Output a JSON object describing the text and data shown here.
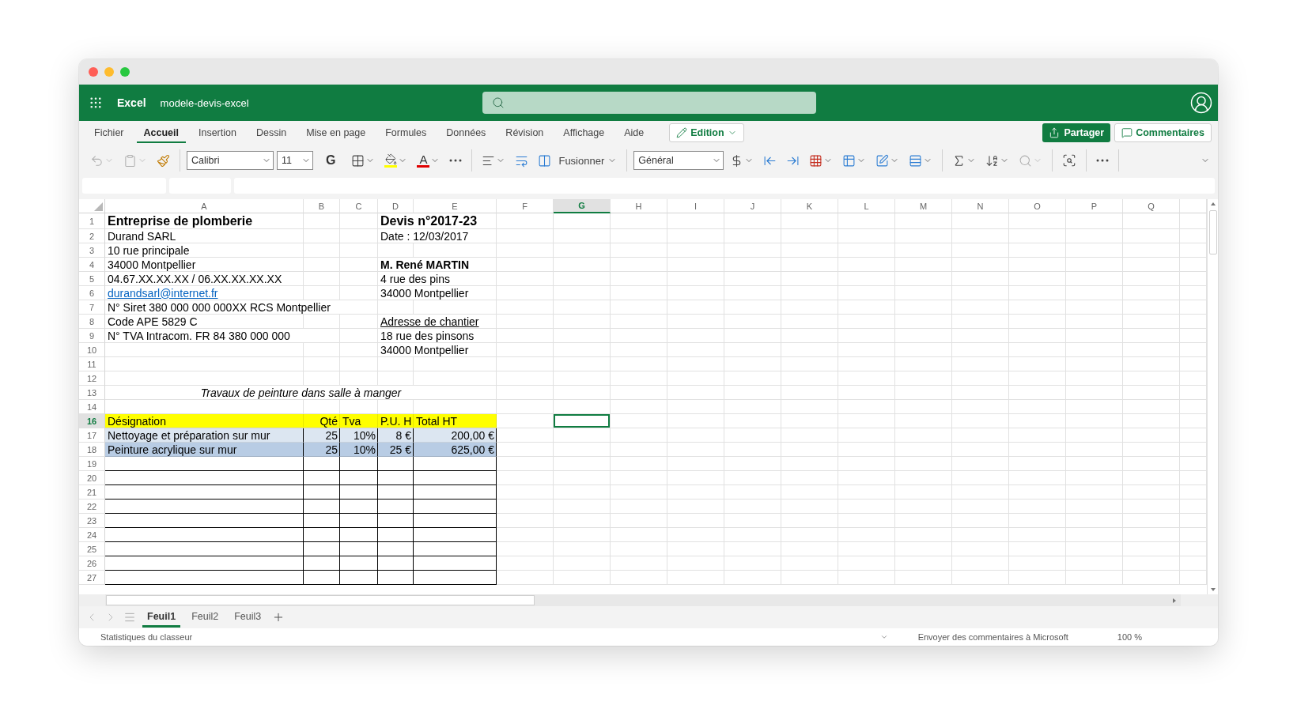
{
  "app_bar": {
    "app_name": "Excel",
    "document": "modele-devis-excel"
  },
  "ribbon_tabs": [
    {
      "label": "Fichier",
      "selected": false
    },
    {
      "label": "Accueil",
      "selected": true
    },
    {
      "label": "Insertion",
      "selected": false
    },
    {
      "label": "Dessin",
      "selected": false
    },
    {
      "label": "Mise en page",
      "selected": false
    },
    {
      "label": "Formules",
      "selected": false
    },
    {
      "label": "Données",
      "selected": false
    },
    {
      "label": "Révision",
      "selected": false
    },
    {
      "label": "Affichage",
      "selected": false
    },
    {
      "label": "Aide",
      "selected": false
    }
  ],
  "mode_button": "Edition",
  "share_button": "Partager",
  "comments_button": "Commentaires",
  "toolbar": {
    "font": "Calibri",
    "size": "11",
    "bold": "G",
    "font_color": "A",
    "merge": "Fusionner",
    "number_format": "Général"
  },
  "columns": [
    {
      "label": "A",
      "selected": false
    },
    {
      "label": "B",
      "selected": false
    },
    {
      "label": "C",
      "selected": false
    },
    {
      "label": "D",
      "selected": false
    },
    {
      "label": "E",
      "selected": false
    },
    {
      "label": "F",
      "selected": false
    },
    {
      "label": "G",
      "selected": true
    },
    {
      "label": "H",
      "selected": false
    },
    {
      "label": "I",
      "selected": false
    },
    {
      "label": "J",
      "selected": false
    },
    {
      "label": "K",
      "selected": false
    },
    {
      "label": "L",
      "selected": false
    },
    {
      "label": "M",
      "selected": false
    },
    {
      "label": "N",
      "selected": false
    },
    {
      "label": "O",
      "selected": false
    },
    {
      "label": "P",
      "selected": false
    },
    {
      "label": "Q",
      "selected": false
    }
  ],
  "rows": [
    {
      "number": "1",
      "selected": false,
      "kind": "plain",
      "cells": {
        "A": {
          "kind": "title",
          "text": "Entreprise de plomberie"
        },
        "D": {
          "kind": "title",
          "text": "Devis n°2017-23"
        }
      }
    },
    {
      "number": "2",
      "selected": false,
      "kind": "plain",
      "cells": {
        "A": {
          "kind": "text",
          "text": "Durand SARL"
        },
        "D": {
          "kind": "text",
          "text": "Date : 12/03/2017"
        }
      }
    },
    {
      "number": "3",
      "selected": false,
      "kind": "plain",
      "cells": {
        "A": {
          "kind": "text",
          "text": "10 rue principale"
        }
      }
    },
    {
      "number": "4",
      "selected": false,
      "kind": "plain",
      "cells": {
        "A": {
          "kind": "text",
          "text": "34000 Montpellier"
        },
        "D": {
          "kind": "bold",
          "text": "M. René MARTIN"
        }
      }
    },
    {
      "number": "5",
      "selected": false,
      "kind": "plain",
      "cells": {
        "A": {
          "kind": "text",
          "text": "04.67.XX.XX.XX / 06.XX.XX.XX.XX"
        },
        "D": {
          "kind": "text",
          "text": "4 rue des pins"
        }
      }
    },
    {
      "number": "6",
      "selected": false,
      "kind": "plain",
      "cells": {
        "A": {
          "kind": "link",
          "text": "durandsarl@internet.fr"
        },
        "D": {
          "kind": "text",
          "text": "34000 Montpellier"
        }
      }
    },
    {
      "number": "7",
      "selected": false,
      "kind": "plain",
      "cells": {
        "A": {
          "kind": "text",
          "text": "N° Siret 380 000 000 000XX RCS Montpellier"
        }
      }
    },
    {
      "number": "8",
      "selected": false,
      "kind": "plain",
      "cells": {
        "A": {
          "kind": "text",
          "text": "Code APE 5829 C"
        },
        "D": {
          "kind": "underline",
          "text": "Adresse de chantier"
        }
      }
    },
    {
      "number": "9",
      "selected": false,
      "kind": "plain",
      "cells": {
        "A": {
          "kind": "text",
          "text": "N° TVA Intracom. FR 84 380 000 000"
        },
        "D": {
          "kind": "text",
          "text": "18 rue des pinsons"
        }
      }
    },
    {
      "number": "10",
      "selected": false,
      "kind": "plain",
      "cells": {
        "D": {
          "kind": "text",
          "text": "34000 Montpellier"
        }
      }
    },
    {
      "number": "11",
      "selected": false,
      "kind": "plain",
      "cells": {}
    },
    {
      "number": "12",
      "selected": false,
      "kind": "plain",
      "cells": {}
    },
    {
      "number": "13",
      "selected": false,
      "kind": "plain",
      "cells": {
        "A": {
          "kind": "italic",
          "text": "Travaux de peinture dans salle à manger"
        }
      }
    },
    {
      "number": "14",
      "selected": false,
      "kind": "plain",
      "cells": {}
    },
    {
      "number": "16",
      "selected": true,
      "kind": "header",
      "cells": {
        "A": {
          "kind": "text",
          "text": "Désignation"
        },
        "B": {
          "kind": "number",
          "text": "Qté"
        },
        "C": {
          "kind": "text",
          "text": "Tva"
        },
        "D": {
          "kind": "text",
          "text": "P.U. H"
        },
        "E": {
          "kind": "text",
          "text": "Total HT"
        }
      }
    },
    {
      "number": "17",
      "selected": false,
      "kind": "band_light",
      "cells": {
        "A": {
          "kind": "text",
          "text": "Nettoyage et préparation sur mur"
        },
        "B": {
          "kind": "number",
          "text": "25"
        },
        "C": {
          "kind": "number",
          "text": "10%"
        },
        "D": {
          "kind": "number",
          "text": "8 €"
        },
        "E": {
          "kind": "number",
          "text": "200,00 €"
        }
      }
    },
    {
      "number": "18",
      "selected": false,
      "kind": "band_dark",
      "cells": {
        "A": {
          "kind": "text",
          "text": "Peinture acrylique sur mur"
        },
        "B": {
          "kind": "number",
          "text": "25"
        },
        "C": {
          "kind": "number",
          "text": "10%"
        },
        "D": {
          "kind": "number",
          "text": "25 €"
        },
        "E": {
          "kind": "number",
          "text": "625,00 €"
        }
      }
    },
    {
      "number": "19",
      "selected": false,
      "kind": "lined",
      "cells": {}
    },
    {
      "number": "20",
      "selected": false,
      "kind": "lined",
      "cells": {}
    },
    {
      "number": "21",
      "selected": false,
      "kind": "lined",
      "cells": {}
    },
    {
      "number": "22",
      "selected": false,
      "kind": "lined",
      "cells": {}
    },
    {
      "number": "23",
      "selected": false,
      "kind": "lined",
      "cells": {}
    },
    {
      "number": "24",
      "selected": false,
      "kind": "lined",
      "cells": {}
    },
    {
      "number": "25",
      "selected": false,
      "kind": "lined",
      "cells": {}
    },
    {
      "number": "26",
      "selected": false,
      "kind": "lined",
      "cells": {}
    },
    {
      "number": "27",
      "selected": false,
      "kind": "lined",
      "cells": {}
    }
  ],
  "sheets": [
    {
      "label": "Feuil1",
      "selected": true
    },
    {
      "label": "Feuil2",
      "selected": false
    },
    {
      "label": "Feuil3",
      "selected": false
    }
  ],
  "status_bar": {
    "workbook_stats": "Statistiques du classeur",
    "feedback": "Envoyer des commentaires à Microsoft",
    "zoom": "100 %"
  }
}
